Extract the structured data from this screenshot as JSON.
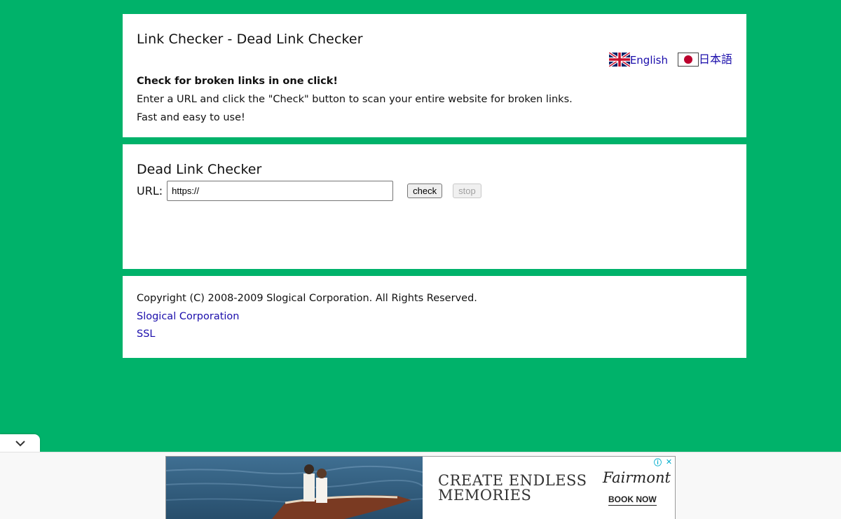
{
  "header": {
    "title": "Link Checker - Dead Link Checker",
    "languages": [
      {
        "label": "English",
        "icon": "uk-flag-icon"
      },
      {
        "label": "日本語",
        "icon": "japan-flag-icon"
      }
    ],
    "tagline": "Check for broken links in one click!",
    "description": "Enter a URL and click the \"Check\" button to scan your entire website for broken links.",
    "note": "Fast and easy to use!"
  },
  "checker": {
    "title": "Dead Link Checker",
    "url_label": "URL:",
    "url_value": "https://",
    "check_label": "check",
    "stop_label": "stop"
  },
  "footer": {
    "copyright": "Copyright (C) 2008-2009 Slogical Corporation. All Rights Reserved.",
    "links": [
      "Slogical Corporation",
      "SSL"
    ]
  },
  "ad": {
    "headline_line1": "CREATE ENDLESS",
    "headline_line2": "MEMORIES",
    "brand": "Fairmont",
    "cta": "BOOK NOW",
    "icons": [
      "info-icon",
      "close-icon"
    ]
  },
  "colors": {
    "background": "#00b26a",
    "panel": "#ffffff",
    "link": "#1a0dab"
  }
}
